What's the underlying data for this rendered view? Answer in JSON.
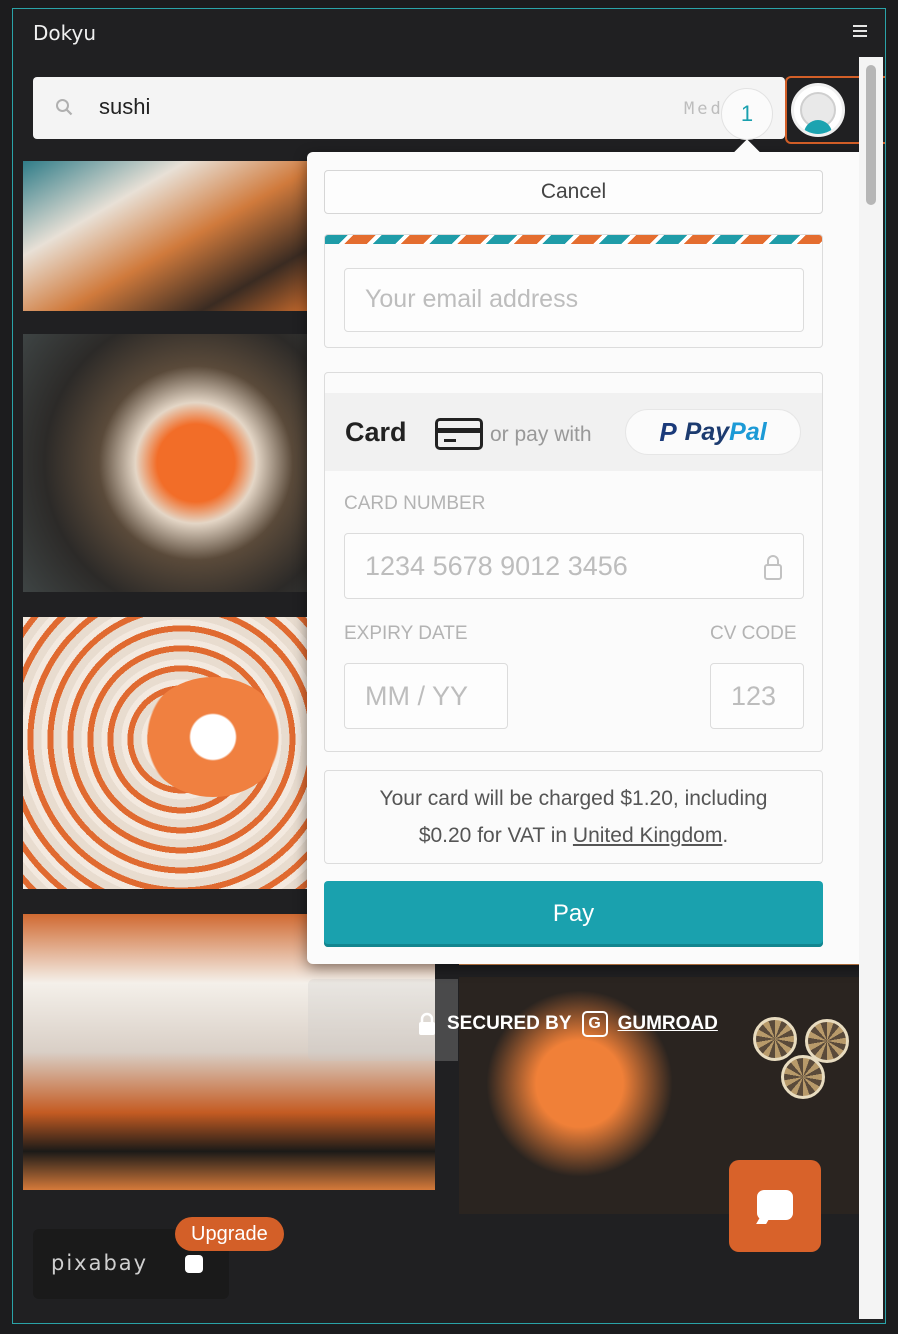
{
  "app": {
    "title": "Dokyu"
  },
  "search": {
    "query": "sushi",
    "media_hint": "Medi"
  },
  "notification_count": "1",
  "checkout": {
    "cancel_label": "Cancel",
    "email_placeholder": "Your email address",
    "card_tab_label": "Card",
    "or_pay_with": "or pay with",
    "paypal_pay": "Pay",
    "paypal_pal": "Pal",
    "card_number_label": "CARD NUMBER",
    "card_number_placeholder": "1234 5678 9012 3456",
    "expiry_label": "EXPIRY DATE",
    "expiry_placeholder": "MM / YY",
    "cvc_label": "CV CODE",
    "cvc_placeholder": "123",
    "charge_text": "Your card will be charged $1.20, including",
    "vat_text": "$0.20 for VAT in",
    "vat_country": "United Kingdom",
    "vat_end": ".",
    "pay_label": "Pay",
    "secured_by": "SECURED BY",
    "gumroad": "GUMROAD"
  },
  "footer": {
    "pixabay": "pixabay",
    "upgrade_label": "Upgrade"
  },
  "colors": {
    "accent": "#1aa1ae",
    "brand_orange": "#d35f28",
    "frame": "#2aa3a8"
  },
  "icons": [
    "menu-icon",
    "search-icon",
    "avatar",
    "credit-card-icon",
    "paypal-icon",
    "lock-icon",
    "gumroad-icon",
    "dice-icon",
    "chat-icon"
  ]
}
